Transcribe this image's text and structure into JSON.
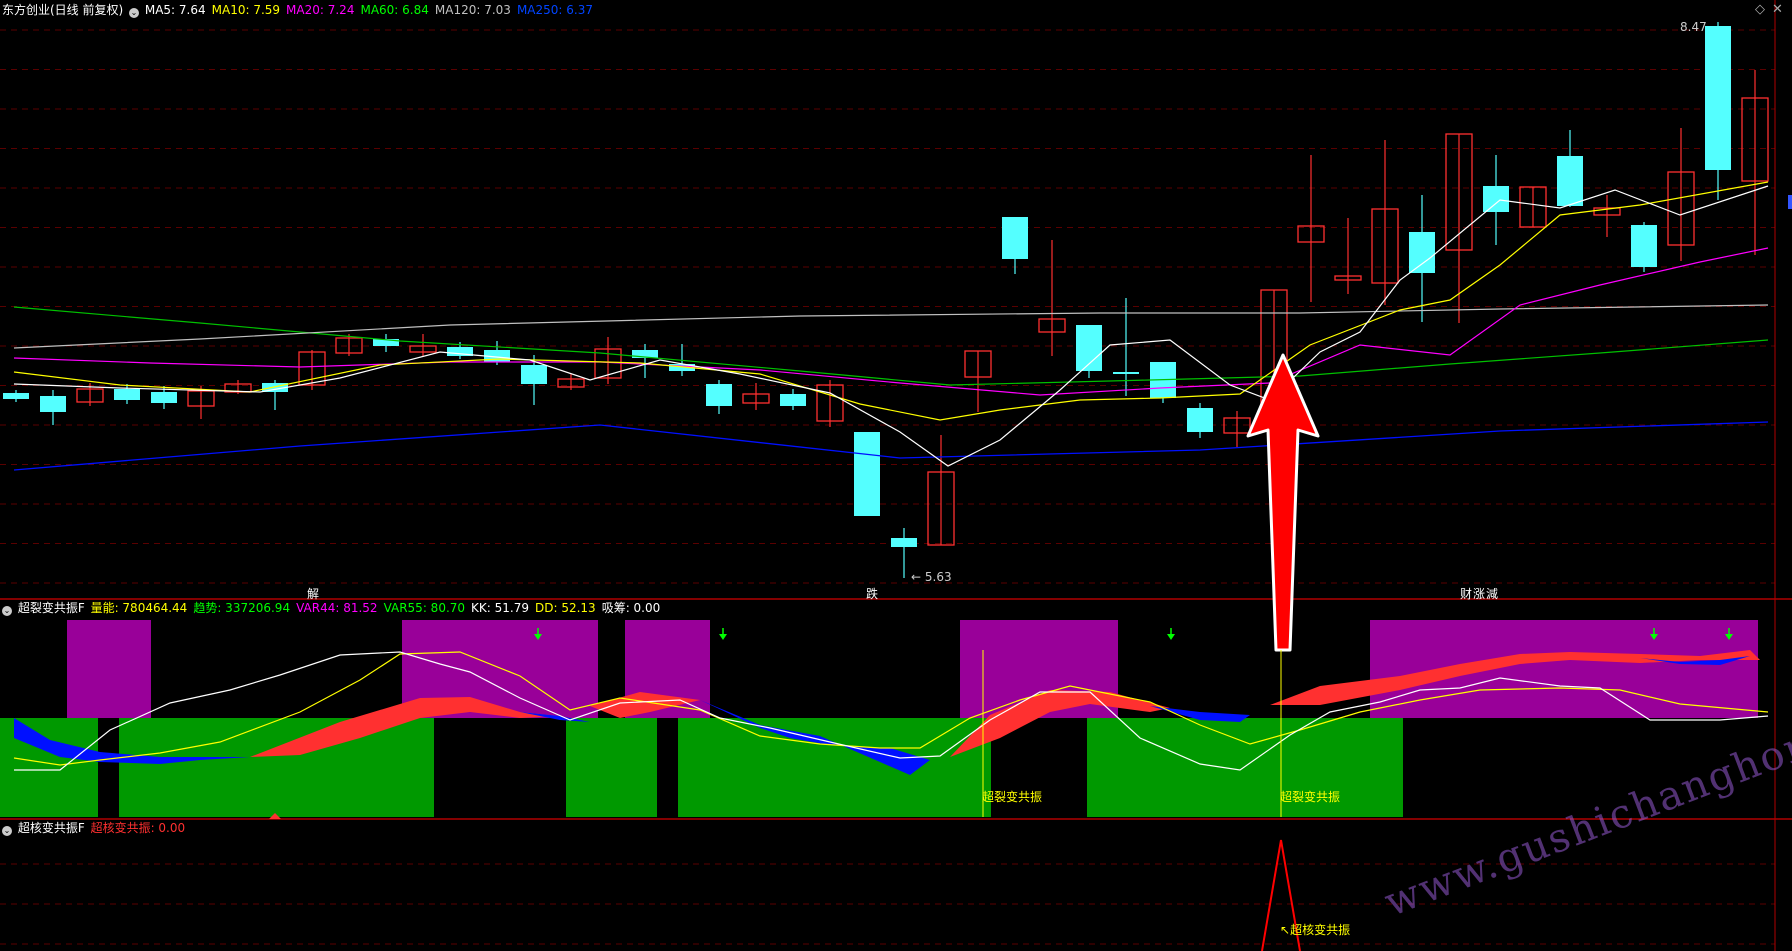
{
  "header": {
    "title": "东方创业(日线 前复权)",
    "ma": [
      {
        "label": "MA5: 7.64",
        "color": "#ffffff"
      },
      {
        "label": "MA10: 7.59",
        "color": "#ffff00"
      },
      {
        "label": "MA20: 7.24",
        "color": "#ff00ff"
      },
      {
        "label": "MA60: 6.84",
        "color": "#00ff00"
      },
      {
        "label": "MA120: 7.03",
        "color": "#c0c0c0"
      },
      {
        "label": "MA250: 6.37",
        "color": "#0044ff"
      }
    ]
  },
  "price_panel": {
    "high_label": "8.47",
    "low_label": "5.63",
    "markers": [
      {
        "text": "解",
        "color": "#00ffff"
      },
      {
        "text": "跌",
        "color": "#00ff00"
      },
      {
        "text": "财",
        "color": "#00ffff"
      },
      {
        "text": "涨",
        "color": "#ff3030"
      },
      {
        "text": "減",
        "color": "#00ff00"
      }
    ]
  },
  "indicator1": {
    "name": "超裂变共振F",
    "fields": [
      {
        "label": "量能: 780464.44",
        "color": "#ffff00"
      },
      {
        "label": "趋势: 337206.94",
        "color": "#00ff00"
      },
      {
        "label": "VAR44: 81.52",
        "color": "#ff00ff"
      },
      {
        "label": "VAR55: 80.70",
        "color": "#00ff00"
      },
      {
        "label": "KK: 51.79",
        "color": "#ffffff"
      },
      {
        "label": "DD: 52.13",
        "color": "#ffff00"
      },
      {
        "label": "吸筹: 0.00",
        "color": "#ffffff"
      }
    ],
    "signal_label": "超裂变共振"
  },
  "indicator2": {
    "name": "超核变共振F",
    "fields": [
      {
        "label": "超核变共振: 0.00",
        "color": "#ff3030"
      }
    ],
    "signal_label": "超核变共振"
  },
  "watermark": "www.gushichanghong.com",
  "colors": {
    "up": "#ff3030",
    "down": "#54ffff",
    "purple": "#990099",
    "green": "#009900",
    "blue": "#0010ff"
  }
}
